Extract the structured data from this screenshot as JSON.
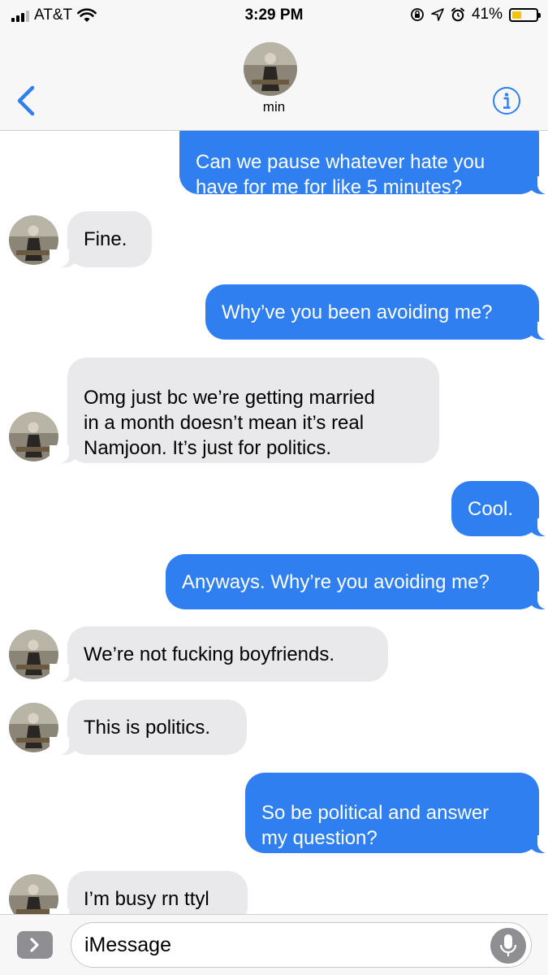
{
  "status_bar": {
    "carrier": "AT&T",
    "time": "3:29 PM",
    "battery_percent": "41%",
    "battery_level": 0.41,
    "icons": [
      "signal-icon",
      "wifi-icon",
      "orientation-lock-icon",
      "location-icon",
      "alarm-icon",
      "battery-icon"
    ]
  },
  "header": {
    "contact_name": "min",
    "back_icon": "chevron-left-icon",
    "info_icon": "info-icon"
  },
  "messages": [
    {
      "direction": "sent",
      "text": "Can we pause whatever hate you have for me for like 5 minutes?",
      "lines": [
        "Can we pause whatever hate you",
        "have for me for like 5 minutes?"
      ]
    },
    {
      "direction": "received",
      "text": "Fine."
    },
    {
      "direction": "sent",
      "text": "Why’ve you been avoiding me?"
    },
    {
      "direction": "received",
      "text": "Omg just bc we’re getting married in a month doesn’t mean it’s real Namjoon. It’s just for politics.",
      "lines": [
        "Omg just bc we’re getting married",
        "in a month doesn’t mean it’s real",
        "Namjoon. It’s just for politics."
      ]
    },
    {
      "direction": "sent",
      "text": "Cool."
    },
    {
      "direction": "sent",
      "text": "Anyways. Why’re you avoiding me?"
    },
    {
      "direction": "received",
      "text": "We’re not fucking boyfriends."
    },
    {
      "direction": "received",
      "text": "This is politics."
    },
    {
      "direction": "sent",
      "text": "So be political and answer my question?",
      "lines": [
        "So be political and answer",
        "my question?"
      ]
    },
    {
      "direction": "received",
      "text": "I’m busy rn ttyl"
    }
  ],
  "composer": {
    "placeholder": "iMessage",
    "apps_icon": "chevron-right-icon",
    "mic_icon": "microphone-icon"
  },
  "colors": {
    "accent": "#2f7ff0",
    "sent_bubble": "#2f7ff0",
    "received_bubble": "#e9e9eb",
    "header_bg": "#f7f7f7",
    "battery_fill": "#f5c400"
  }
}
